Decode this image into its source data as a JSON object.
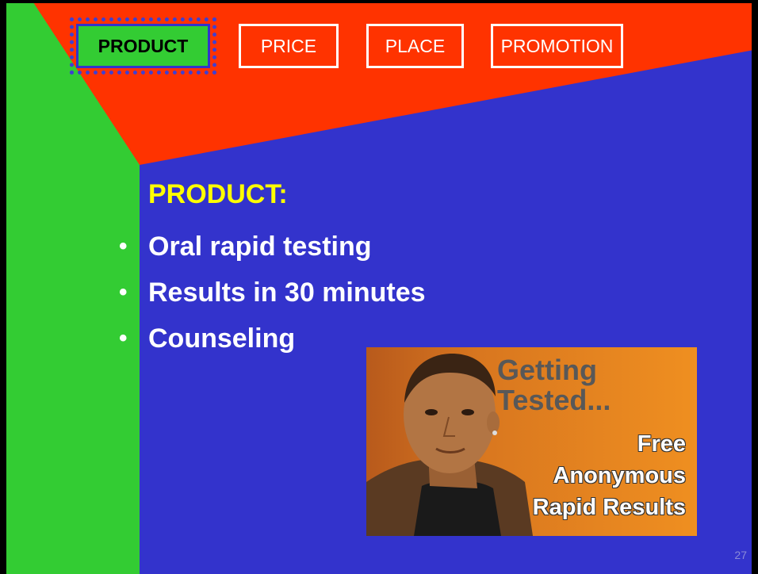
{
  "tabs": [
    {
      "label": "PRODUCT",
      "active": true
    },
    {
      "label": "PRICE",
      "active": false
    },
    {
      "label": "PLACE",
      "active": false
    },
    {
      "label": "PROMOTION",
      "active": false
    }
  ],
  "content": {
    "heading": "PRODUCT:",
    "bullets": [
      "Oral rapid testing",
      "Results in 30 minutes",
      "Counseling"
    ]
  },
  "image": {
    "title_line1": "Getting",
    "title_line2": "Tested...",
    "line1": "Free",
    "line2": "Anonymous",
    "line3": "Rapid Results"
  },
  "page_number": "27",
  "colors": {
    "blue": "#3333cc",
    "red": "#ff3300",
    "green": "#33cc33",
    "yellow": "#ffff00"
  }
}
